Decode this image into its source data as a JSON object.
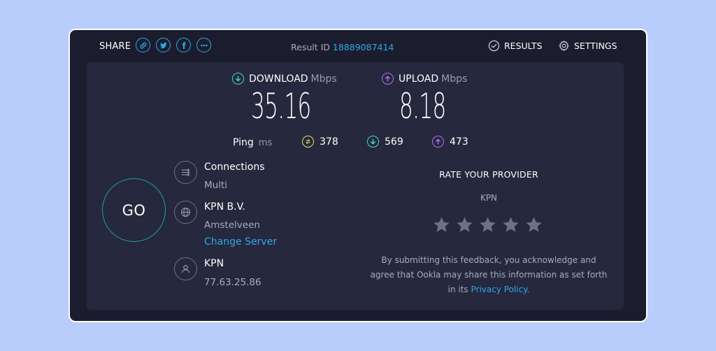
{
  "header": {
    "share_label": "SHARE",
    "share_buttons": [
      {
        "icon": "link-icon"
      },
      {
        "icon": "twitter-icon"
      },
      {
        "icon": "facebook-icon"
      },
      {
        "icon": "more-icon"
      }
    ],
    "result_id_label": "Result ID",
    "result_id_value": "18889087414",
    "results_label": "RESULTS",
    "settings_label": "SETTINGS"
  },
  "metrics": {
    "download": {
      "label": "DOWNLOAD",
      "unit": "Mbps",
      "value": "35.16",
      "color": "#3ed9c7"
    },
    "upload": {
      "label": "UPLOAD",
      "unit": "Mbps",
      "value": "8.18",
      "color": "#b26cf0"
    }
  },
  "ping": {
    "label": "Ping",
    "unit": "ms",
    "idle": {
      "value": "378",
      "icon": "ping-idle-icon",
      "color": "#e2e35a"
    },
    "download": {
      "value": "569",
      "icon": "ping-download-icon",
      "color": "#3ed9c7"
    },
    "upload": {
      "value": "473",
      "icon": "ping-upload-icon",
      "color": "#b26cf0"
    }
  },
  "go_label": "GO",
  "connections": {
    "title": "Connections",
    "value": "Multi"
  },
  "server": {
    "title": "KPN B.V.",
    "location": "Amstelveen",
    "change_label": "Change Server"
  },
  "isp": {
    "title": "KPN",
    "ip": "77.63.25.86"
  },
  "rating": {
    "title": "RATE YOUR PROVIDER",
    "provider": "KPN",
    "stars": 5,
    "disclaimer_text": "By submitting this feedback, you acknowledge and agree that Ookla may share this information as set forth in its",
    "policy_link": "Privacy Policy."
  },
  "colors": {
    "accent": "#2ea8ea",
    "background": "#b8cdfb",
    "panel": "#26283d",
    "window": "#1b1d2e"
  }
}
